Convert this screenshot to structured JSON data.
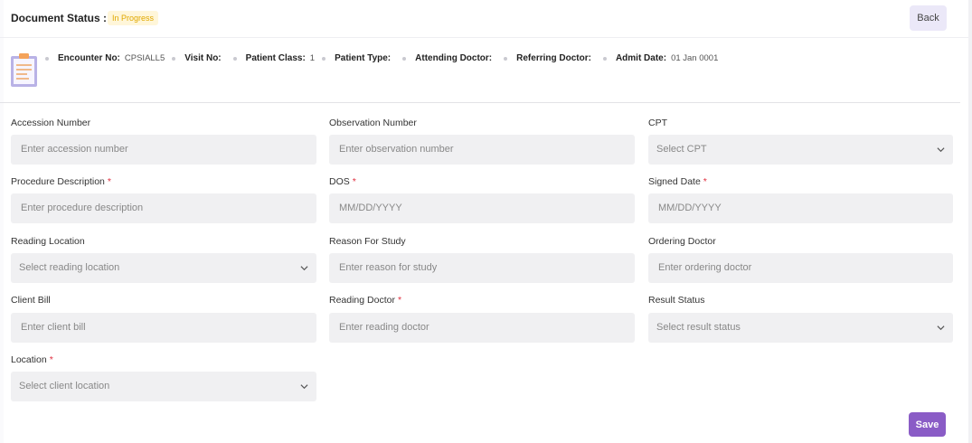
{
  "header": {
    "document_status_label": "Document Status :",
    "status_badge": "In Progress",
    "back_label": "Back"
  },
  "encounter": {
    "icon": "clipboard-icon",
    "items": [
      {
        "key": "Encounter No:",
        "value": "CPSIALL5"
      },
      {
        "key": "Visit No:",
        "value": ""
      },
      {
        "key": "Patient Class:",
        "value": "1"
      },
      {
        "key": "Patient Type:",
        "value": ""
      },
      {
        "key": "Attending Doctor:",
        "value": ""
      },
      {
        "key": "Referring Doctor:",
        "value": ""
      },
      {
        "key": "Admit Date:",
        "value": "01 Jan 0001"
      }
    ]
  },
  "form": {
    "accession_number": {
      "label": "Accession Number",
      "placeholder": "Enter accession number"
    },
    "observation_number": {
      "label": "Observation Number",
      "placeholder": "Enter observation number"
    },
    "cpt": {
      "label": "CPT",
      "placeholder": "Select CPT"
    },
    "procedure_description": {
      "label": "Procedure Description",
      "placeholder": "Enter procedure description",
      "required": "*"
    },
    "dos": {
      "label": "DOS",
      "placeholder": "MM/DD/YYYY",
      "required": "*"
    },
    "signed_date": {
      "label": "Signed Date",
      "placeholder": "MM/DD/YYYY",
      "required": "*"
    },
    "reading_location": {
      "label": "Reading Location",
      "placeholder": "Select reading location"
    },
    "reason_for_study": {
      "label": "Reason For Study",
      "placeholder": "Enter reason for study"
    },
    "ordering_doctor": {
      "label": "Ordering Doctor",
      "placeholder": "Enter ordering doctor"
    },
    "client_bill": {
      "label": "Client Bill",
      "placeholder": "Enter client bill"
    },
    "reading_doctor": {
      "label": "Reading Doctor",
      "placeholder": "Enter reading doctor",
      "required": "*"
    },
    "result_status": {
      "label": "Result Status",
      "placeholder": "Select result status"
    },
    "location": {
      "label": "Location",
      "placeholder": "Select client location",
      "required": "*"
    }
  },
  "save_label": "Save",
  "colors": {
    "accent": "#8a5cc6",
    "back_button_bg": "#ebe8f8",
    "badge_text": "#e0a800",
    "badge_bg": "#fff6d9",
    "field_bg": "#f0f0f2",
    "required": "#e03040"
  }
}
